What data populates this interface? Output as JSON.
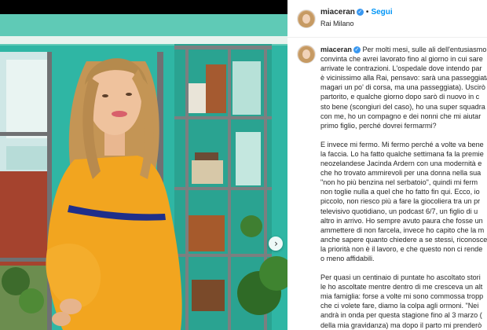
{
  "header": {
    "username": "miaceran",
    "follow_label": "Segui",
    "location": "Rai Milano"
  },
  "caption": {
    "username": "miaceran",
    "lines": [
      "Per molti mesi, sulle ali dell'entusiasmo",
      "convinta che avrei lavorato fino al giorno in cui sare",
      "arrivate le contrazioni. L'ospedale dove intendo par",
      "è vicinissimo alla Rai, pensavo: sarà una passeggiata",
      "magari un po' di corsa, ma una passeggiata). Uscirò",
      "partorito, e qualche giorno dopo sarò di nuovo in c",
      "sto bene (scongiuri del caso), ho una super squadra",
      "con me, ho un compagno e dei nonni che mi aiutar",
      "primo figlio, perché dovrei fermarmi?",
      "",
      "E invece mi fermo. Mi fermo perché a volte va bene",
      "la faccia. Lo ha fatto qualche settimana fa la premie",
      "neozelandese Jacinda Ardern con una modernità e",
      "che ho trovato ammirevoli per una donna nella sua",
      "\"non ho più benzina nel serbatoio\", quindi mi ferm",
      "non toglie nulla a quel che ho fatto fin qui. Ecco, io",
      "piccolo, non riesco più a fare la giocoliera tra un pr",
      "televisivo quotidiano, un podcast 6/7, un figlio di u",
      "altro in arrivo. Ho sempre avuto paura che fosse un",
      "ammettere di non farcela, invece ho capito che la m",
      "anche sapere quanto chiedere a se stessi, riconosce",
      "la priorità non è il lavoro, e che questo non ci rende",
      "o meno affidabili.",
      "",
      "Per quasi un centinaio di puntate ho ascoltato stori",
      "le ho ascoltate mentre dentro di me cresceva un alt",
      "mia famiglia: forse a volte mi sono commossa tropp",
      "che ci volete fare, diamo la colpa agli ormoni. \"Nei",
      "andrà in onda per questa stagione fino al 3 marzo (",
      "della mia gravidanza) ma dopo il parto mi prenderò"
    ]
  },
  "colors": {
    "link_blue": "#0095f6",
    "verified_blue": "#3897f0",
    "dress_yellow": "#f2a51f",
    "studio_teal": "#2fb6a4"
  },
  "icons": {
    "next": "chevron-right-icon",
    "verified": "verified-badge-icon"
  }
}
